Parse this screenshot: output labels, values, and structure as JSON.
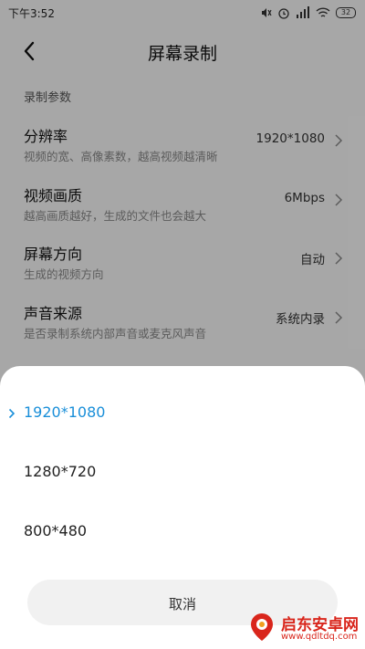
{
  "status_bar": {
    "time": "下午3:52",
    "battery": "32",
    "icons": [
      "mute-icon",
      "alarm-icon",
      "signal-4g-icon",
      "wifi-icon",
      "battery-icon"
    ]
  },
  "header": {
    "title": "屏幕录制",
    "back_icon": "chevron-left-icon"
  },
  "section": {
    "label": "录制参数"
  },
  "settings": [
    {
      "title": "分辨率",
      "subtitle": "视频的宽、高像素数，越高视频越清晰",
      "value": "1920*1080"
    },
    {
      "title": "视频画质",
      "subtitle": "越高画质越好，生成的文件也会越大",
      "value": "6Mbps"
    },
    {
      "title": "屏幕方向",
      "subtitle": "生成的视频方向",
      "value": "自动"
    },
    {
      "title": "声音来源",
      "subtitle": "是否录制系统内部声音或麦克风声音",
      "value": "系统内录"
    }
  ],
  "sheet": {
    "options": [
      {
        "label": "1920*1080",
        "selected": true
      },
      {
        "label": "1280*720",
        "selected": false
      },
      {
        "label": "800*480",
        "selected": false
      }
    ],
    "cancel_label": "取消"
  },
  "watermark": {
    "name": "启东安卓网",
    "url": "www.qdltdq.com"
  },
  "colors": {
    "accent": "#1a8fd9",
    "brand": "#d9261c",
    "dim_overlay": "rgba(0,0,0,0.32)"
  }
}
